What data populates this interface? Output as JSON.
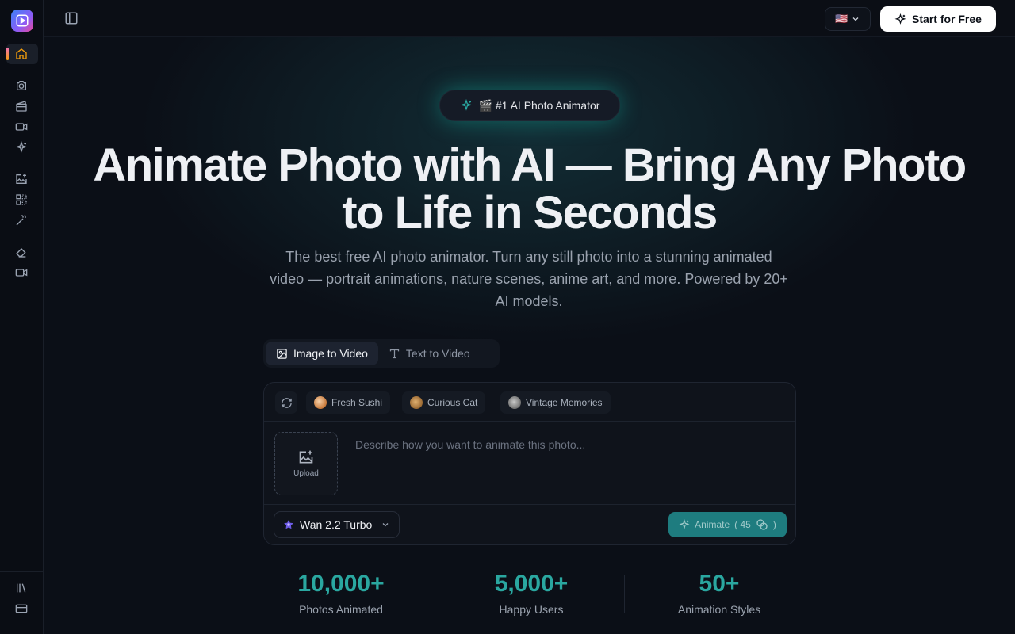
{
  "topbar": {
    "language_flag": "🇺🇸",
    "start_label": "Start for Free"
  },
  "sidebar": {
    "items": [
      {
        "icon": "home-icon"
      },
      {
        "icon": "camera-icon"
      },
      {
        "icon": "film-icon"
      },
      {
        "icon": "video-icon"
      },
      {
        "icon": "sparkles-icon"
      },
      {
        "icon": "image-plus-icon"
      },
      {
        "icon": "grid-icon"
      },
      {
        "icon": "magic-wand-icon"
      },
      {
        "icon": "eraser-icon"
      },
      {
        "icon": "video-camera-icon"
      }
    ],
    "bottom": [
      {
        "icon": "library-icon"
      },
      {
        "icon": "credit-card-icon"
      }
    ]
  },
  "hero": {
    "badge": "🎬 #1 AI Photo Animator",
    "title_line1": "Animate Photo with AI — Bring Any Photo",
    "title_line2": "to Life in Seconds",
    "subtitle": "The best free AI photo animator. Turn any still photo into a stunning animated video — portrait animations, nature scenes, anime art, and more. Powered by 20+ AI models."
  },
  "tabs": [
    {
      "label": "Image to Video",
      "active": true
    },
    {
      "label": "Text to Video",
      "active": false
    }
  ],
  "composer": {
    "presets": [
      "Fresh Sushi",
      "Curious Cat",
      "Vintage Memories"
    ],
    "upload_label": "Upload",
    "prompt_placeholder": "Describe how you want to animate this photo...",
    "model": "Wan 2.2 Turbo",
    "animate_label": "Animate",
    "animate_cost": "( 45",
    "animate_cost_close": ")"
  },
  "stats": [
    {
      "value": "10,000+",
      "label": "Photos Animated"
    },
    {
      "value": "5,000+",
      "label": "Happy Users"
    },
    {
      "value": "50+",
      "label": "Animation Styles"
    }
  ],
  "colors": {
    "accent": "#2aa7a0",
    "background": "#0b0f17",
    "animate_button": "#1e7c7f"
  }
}
